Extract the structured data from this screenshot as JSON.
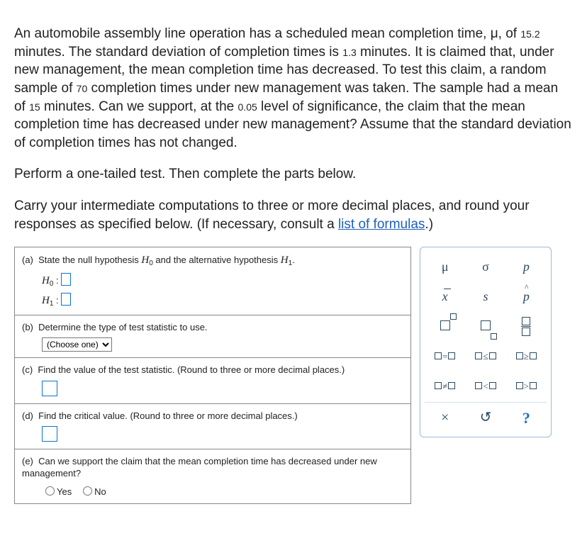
{
  "problem": {
    "p1_a": "An automobile assembly line operation has a scheduled mean completion time, μ, of ",
    "v1": "15.2",
    "p1_b": " minutes. The standard deviation of completion times is ",
    "v2": "1.3",
    "p1_c": " minutes. It is claimed that, under new management, the mean completion time has decreased. To test this claim, a random sample of ",
    "v3": "70",
    "p1_d": " completion times under new management was taken. The sample had a mean of ",
    "v4": "15",
    "p1_e": " minutes. Can we support, at the ",
    "v5": "0.05",
    "p1_f": " level of significance, the claim that the mean completion time has decreased under new management? Assume that the standard deviation of completion times has not changed.",
    "p2": "Perform a one-tailed test. Then complete the parts below.",
    "p3_a": "Carry your intermediate computations to three or more decimal places, and round your responses as specified below. (If necessary, consult a ",
    "link": "list of formulas",
    "p3_b": ".)"
  },
  "parts": {
    "a": {
      "prompt_a": "State the null hypothesis ",
      "h0sym": "H",
      "h0sub": "0",
      "prompt_b": " and the alternative hypothesis ",
      "h1sym": "H",
      "h1sub": "1",
      "prompt_c": ".",
      "line1_label": "H",
      "line1_sub": "0",
      "colon": " :",
      "line2_label": "H",
      "line2_sub": "1"
    },
    "b": {
      "prompt": "Determine the type of test statistic to use.",
      "select_label": "(Choose one)"
    },
    "c": {
      "prompt": "Find the value of the test statistic. (Round to three or more decimal places.)"
    },
    "d": {
      "prompt": "Find the critical value. (Round to three or more decimal places.)"
    },
    "e": {
      "prompt": "Can we support the claim that the mean completion time has decreased under new management?",
      "yes": "Yes",
      "no": "No"
    },
    "tags": {
      "a": "(a)",
      "b": "(b)",
      "c": "(c)",
      "d": "(d)",
      "e": "(e)"
    }
  },
  "palette": {
    "mu": "μ",
    "sigma": "σ",
    "p": "p",
    "xbar": "x",
    "s": "s",
    "phat": "p",
    "eq": "=",
    "le": "≤",
    "ge": "≥",
    "ne": "≠",
    "lt": "<",
    "gt": ">",
    "clear": "×",
    "reset": "↺",
    "help": "?"
  }
}
